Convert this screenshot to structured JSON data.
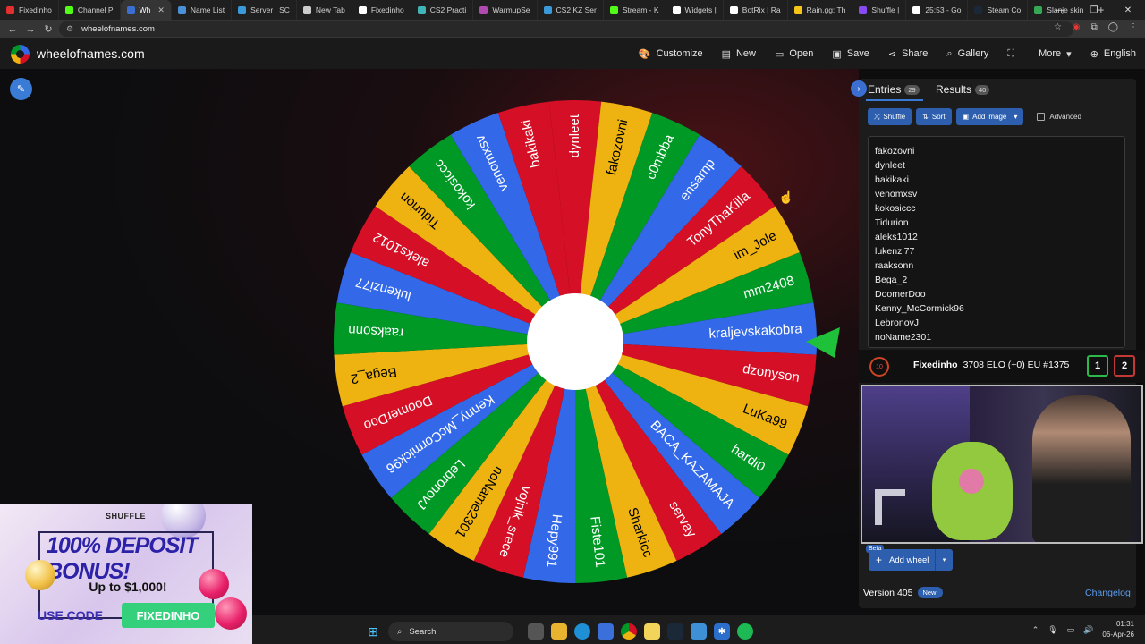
{
  "browser": {
    "tabs": [
      {
        "label": "Fixedinho",
        "color": "#e23030"
      },
      {
        "label": "Channel P",
        "color": "#53fc18"
      },
      {
        "label": "Wh",
        "color": "#3a6fd1",
        "active": true
      },
      {
        "label": "Name List",
        "color": "#4a90d9"
      },
      {
        "label": "Server | SC",
        "color": "#3a9ad9"
      },
      {
        "label": "New Tab",
        "color": "#cccccc"
      },
      {
        "label": "Fixedinho",
        "color": "#ffffff"
      },
      {
        "label": "CS2 Practi",
        "color": "#3fb5b5"
      },
      {
        "label": "WarmupSe",
        "color": "#b04ab0"
      },
      {
        "label": "CS2 KZ Ser",
        "color": "#3a9ad9"
      },
      {
        "label": "Stream - K",
        "color": "#53fc18"
      },
      {
        "label": "Widgets |",
        "color": "#ffffff"
      },
      {
        "label": "BotRix | Ra",
        "color": "#ffffff"
      },
      {
        "label": "Rain.gg: Th",
        "color": "#f5c518"
      },
      {
        "label": "Shuffle |",
        "color": "#8a4af3"
      },
      {
        "label": "25:53 - Go",
        "color": "#ffffff"
      },
      {
        "label": "Steam Co",
        "color": "#1b2838"
      },
      {
        "label": "Slanje skin",
        "color": "#34a853"
      }
    ],
    "new_tab": "+",
    "url": "wheelofnames.com"
  },
  "header": {
    "site_name": "wheelofnames.com",
    "menu": [
      {
        "label": "Customize",
        "icon": "palette-icon",
        "glyph": "🎨"
      },
      {
        "label": "New",
        "icon": "file-icon",
        "glyph": "▤"
      },
      {
        "label": "Open",
        "icon": "folder-icon",
        "glyph": "▭"
      },
      {
        "label": "Save",
        "icon": "save-icon",
        "glyph": "▣"
      },
      {
        "label": "Share",
        "icon": "share-icon",
        "glyph": "⋖"
      },
      {
        "label": "Gallery",
        "icon": "search-icon",
        "glyph": "⌕"
      },
      {
        "label": "",
        "icon": "fullscreen-icon",
        "glyph": "⛶"
      },
      {
        "label": "More",
        "icon": "chevron-down-icon",
        "glyph": "▾"
      },
      {
        "label": "English",
        "icon": "globe-icon",
        "glyph": "⊕"
      }
    ]
  },
  "wheel": {
    "colors": [
      "#3369e8",
      "#d50f25",
      "#eeb211",
      "#009925"
    ],
    "names": [
      "dynleet",
      "fakozovni",
      "c0mbba",
      "ensarnp",
      "TonyThaKilla",
      "im_Jole",
      "mm2408",
      "kraljevskakobra",
      "dzonyson",
      "LuKa99",
      "hardi0",
      "BACA_KAZAMAJA",
      "servay",
      "Sharkicc",
      "Fiste101",
      "Hepy991",
      "vojnik_srece",
      "noName2301",
      "LebronovJ",
      "Kenny_McCormick96",
      "DoomerDoo",
      "Bega_2",
      "raaksonn",
      "lukenzi77",
      "aleks1012",
      "Tidurion",
      "kokosiccc",
      "venomxsv",
      "bakikaki"
    ]
  },
  "panel": {
    "tabs": [
      {
        "label": "Entries",
        "count": "29"
      },
      {
        "label": "Results",
        "count": "40"
      }
    ],
    "tools": {
      "shuffle": "Shuffle",
      "sort": "Sort",
      "add_image": "Add image",
      "advanced": "Advanced"
    },
    "entries": [
      "fakozovni",
      "dynleet",
      "bakikaki",
      "venomxsv",
      "kokosiccc",
      "Tidurion",
      "aleks1012",
      "lukenzi77",
      "raaksonn",
      "Bega_2",
      "DoomerDoo",
      "Kenny_McCormick96",
      "LebronovJ",
      "noName2301"
    ],
    "add_wheel": "Add wheel",
    "beta": "Beta",
    "version": "Version 405",
    "new_badge": "New!",
    "changelog": "Changelog"
  },
  "overlay": {
    "rank": "10",
    "player": "Fixedinho",
    "stats": "3708 ELO (+0) EU #1375",
    "score_a": "1",
    "score_b": "2"
  },
  "ad": {
    "brand": "SHUFFLE",
    "headline": "100% DEPOSIT BONUS!",
    "up_to": "Up to $1,000!",
    "use_code": "USE CODE",
    "code": "FIXEDINHO"
  },
  "taskbar": {
    "search": "Search",
    "time": "01:31",
    "date": "06-Apr-26"
  }
}
